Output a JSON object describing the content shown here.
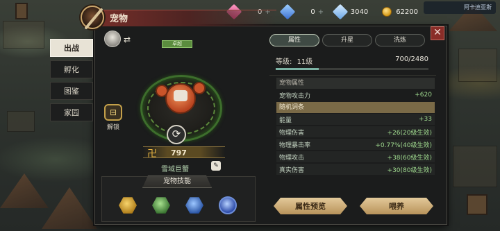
{
  "colors": {
    "accent_red": "#7a2f2a",
    "positive": "#9fd98e",
    "gold": "#c4a04a",
    "panel": "#1b1c1c"
  },
  "top_bar": {
    "resource_1": {
      "icon": "pink-crystal-icon",
      "value": "0"
    },
    "resource_2": {
      "icon": "blue-crystal-icon",
      "value": "0"
    },
    "resource_3": {
      "icon": "diamond-icon",
      "value": "3040"
    },
    "resource_4": {
      "icon": "gold-coin-icon",
      "value": "62200"
    },
    "plus": "+",
    "badge": "阿卡迪亚斯"
  },
  "window": {
    "title": "宠物"
  },
  "side_tabs": [
    {
      "label": "出战",
      "active": true
    },
    {
      "label": "孵化",
      "active": false
    },
    {
      "label": "图鉴",
      "active": false
    },
    {
      "label": "家园",
      "active": false
    }
  ],
  "pet": {
    "rank": "卓越",
    "unlock_label": "解锁",
    "power": "797",
    "name": "雪域巨蟹"
  },
  "skills": {
    "title": "宠物技能",
    "items": [
      {
        "icon": "gold-gem-skill-icon",
        "color": "#d4a52e"
      },
      {
        "icon": "green-claw-skill-icon",
        "color": "#4f9a46"
      },
      {
        "icon": "blue-lightning-skill-icon",
        "color": "#3d6fc4"
      },
      {
        "icon": "blue-swirl-skill-icon",
        "color": "#4a6fd1"
      }
    ]
  },
  "tabs": [
    {
      "label": "属性",
      "active": true
    },
    {
      "label": "升星",
      "active": false
    },
    {
      "label": "洗炼",
      "active": false
    }
  ],
  "level": {
    "label": "等级:",
    "value": "11级",
    "exp": "700/2480",
    "progress": 0.28
  },
  "attributes": {
    "header": "宠物属性",
    "base": [
      {
        "name": "宠物攻击力",
        "value": "+620"
      }
    ],
    "random_header": "随机词条",
    "random": [
      {
        "name": "能量",
        "value": "+33"
      },
      {
        "name": "物理伤害",
        "value": "+26(20级生效)"
      },
      {
        "name": "物理暴击率",
        "value": "+0.77%(40级生效)"
      },
      {
        "name": "物理攻击",
        "value": "+38(60级生效)"
      },
      {
        "name": "真实伤害",
        "value": "+30(80级生效)"
      }
    ]
  },
  "buttons": {
    "preview": "属性预览",
    "feed": "喂养"
  },
  "close_glyph": "✕",
  "refresh_glyph": "⟳",
  "swap_glyph": "⇄",
  "edit_glyph": "✎",
  "power_glyph": "卍",
  "lock_glyph": "⊟"
}
